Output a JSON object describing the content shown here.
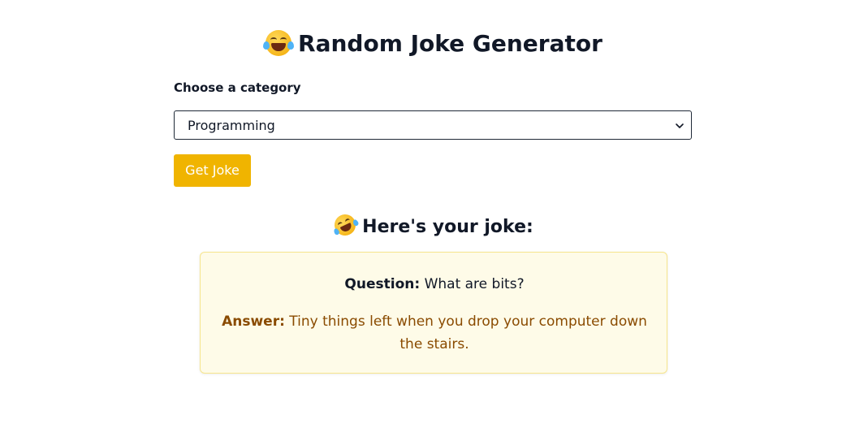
{
  "header": {
    "title": "Random Joke Generator",
    "title_icon": "laughing-tears-emoji"
  },
  "form": {
    "category_label": "Choose a category",
    "category_selected": "Programming",
    "get_button_label": "Get Joke",
    "button_color": "#f0b400"
  },
  "joke": {
    "heading": "Here's your joke:",
    "heading_icon": "rolling-laughing-emoji",
    "question_label": "Question:",
    "question_text": "What are bits?",
    "answer_label": "Answer:",
    "answer_text": "Tiny things left when you drop your computer down the stairs.",
    "card_background": "#fefbe8",
    "answer_color": "#8a4b00"
  }
}
